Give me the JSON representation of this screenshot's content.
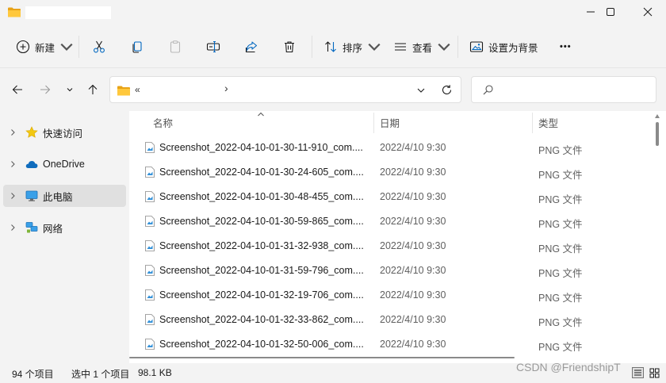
{
  "colors": {
    "folder": "#ffc83d",
    "accent": "#0067c0",
    "onedrive": "#0f6cbd",
    "star": "#f2c811"
  },
  "toolbar": {
    "new_label": "新建",
    "sort_label": "排序",
    "view_label": "查看",
    "background_label": "设置为背景",
    "more_label": "•••"
  },
  "address": {
    "prefix": "«",
    "separator": "›"
  },
  "sidebar": {
    "items": [
      {
        "label": "快速访问",
        "icon": "star-icon"
      },
      {
        "label": "OneDrive",
        "icon": "cloud-icon"
      },
      {
        "label": "此电脑",
        "icon": "monitor-icon",
        "selected": true
      },
      {
        "label": "网络",
        "icon": "network-icon"
      }
    ]
  },
  "columns": {
    "name": "名称",
    "date": "日期",
    "type": "类型"
  },
  "files": [
    {
      "name": "Screenshot_2022-04-10-01-30-11-910_com....",
      "date": "2022/4/10 9:30",
      "type": "PNG 文件"
    },
    {
      "name": "Screenshot_2022-04-10-01-30-24-605_com....",
      "date": "2022/4/10 9:30",
      "type": "PNG 文件"
    },
    {
      "name": "Screenshot_2022-04-10-01-30-48-455_com....",
      "date": "2022/4/10 9:30",
      "type": "PNG 文件"
    },
    {
      "name": "Screenshot_2022-04-10-01-30-59-865_com....",
      "date": "2022/4/10 9:30",
      "type": "PNG 文件"
    },
    {
      "name": "Screenshot_2022-04-10-01-31-32-938_com....",
      "date": "2022/4/10 9:30",
      "type": "PNG 文件"
    },
    {
      "name": "Screenshot_2022-04-10-01-31-59-796_com....",
      "date": "2022/4/10 9:30",
      "type": "PNG 文件"
    },
    {
      "name": "Screenshot_2022-04-10-01-32-19-706_com....",
      "date": "2022/4/10 9:30",
      "type": "PNG 文件"
    },
    {
      "name": "Screenshot_2022-04-10-01-32-33-862_com....",
      "date": "2022/4/10 9:30",
      "type": "PNG 文件"
    },
    {
      "name": "Screenshot_2022-04-10-01-32-50-006_com....",
      "date": "2022/4/10 9:30",
      "type": "PNG 文件"
    }
  ],
  "status": {
    "count": "94 个项目",
    "selection": "选中 1 个项目",
    "size": "98.1 KB"
  },
  "watermark": "CSDN @FriendshipT"
}
